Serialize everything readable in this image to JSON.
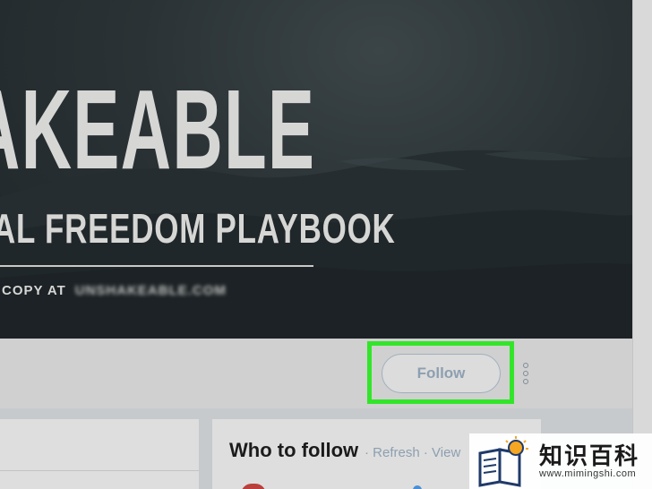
{
  "banner": {
    "line1": "AKEABLE",
    "line2": "AL FREEDOM PLAYBOOK",
    "line3": "COPY AT",
    "line3_blurred": "UNSHAKEABLE.COM"
  },
  "profile_actions": {
    "follow_label": "Follow",
    "more_icon": "vertical-ellipsis-icon",
    "highlight_color": "#33e52a"
  },
  "who_to_follow": {
    "title": "Who to follow",
    "separator": "·",
    "refresh_label": "Refresh",
    "view_label": "View"
  },
  "watermark": {
    "chinese_text": "知识百科",
    "url": "www.mimingshi.com",
    "logo_icon": "book-lightbulb-icon"
  },
  "colors": {
    "accent_link": "#8d9fb0",
    "banner_bg": "#2a3235",
    "page_bg": "#d0d0d0"
  }
}
